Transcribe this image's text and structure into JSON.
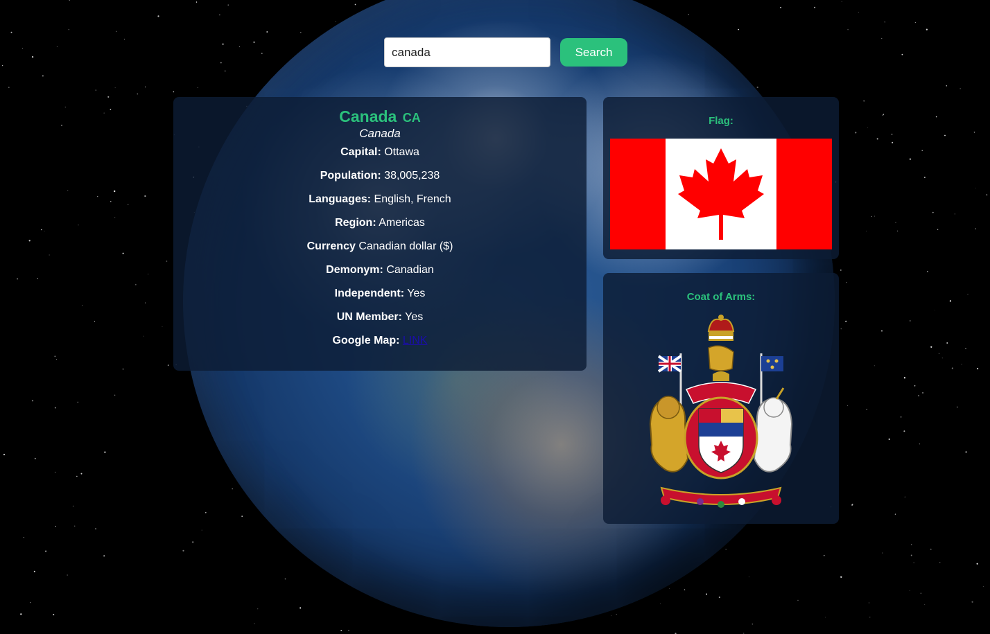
{
  "search": {
    "value": "canada",
    "button_label": "Search"
  },
  "country": {
    "name": "Canada",
    "code": "CA",
    "native_name": "Canada",
    "fields": [
      {
        "label": "Capital:",
        "value": "Ottawa"
      },
      {
        "label": "Population:",
        "value": "38,005,238"
      },
      {
        "label": "Languages:",
        "value": "English, French"
      },
      {
        "label": "Region:",
        "value": "Americas"
      },
      {
        "label": "Currency",
        "value": "Canadian dollar ($)"
      },
      {
        "label": "Demonym:",
        "value": "Canadian"
      },
      {
        "label": "Independent:",
        "value": "Yes"
      },
      {
        "label": "UN Member:",
        "value": "Yes"
      }
    ],
    "google_map": {
      "label": "Google Map:",
      "link_text": "LINK"
    }
  },
  "flag": {
    "label": "Flag:"
  },
  "coat_of_arms": {
    "label": "Coat of Arms:"
  },
  "colors": {
    "accent": "#2bc17c",
    "panel": "#0c1c34",
    "flag_red": "#ff0000",
    "link": "#1a0dab"
  }
}
